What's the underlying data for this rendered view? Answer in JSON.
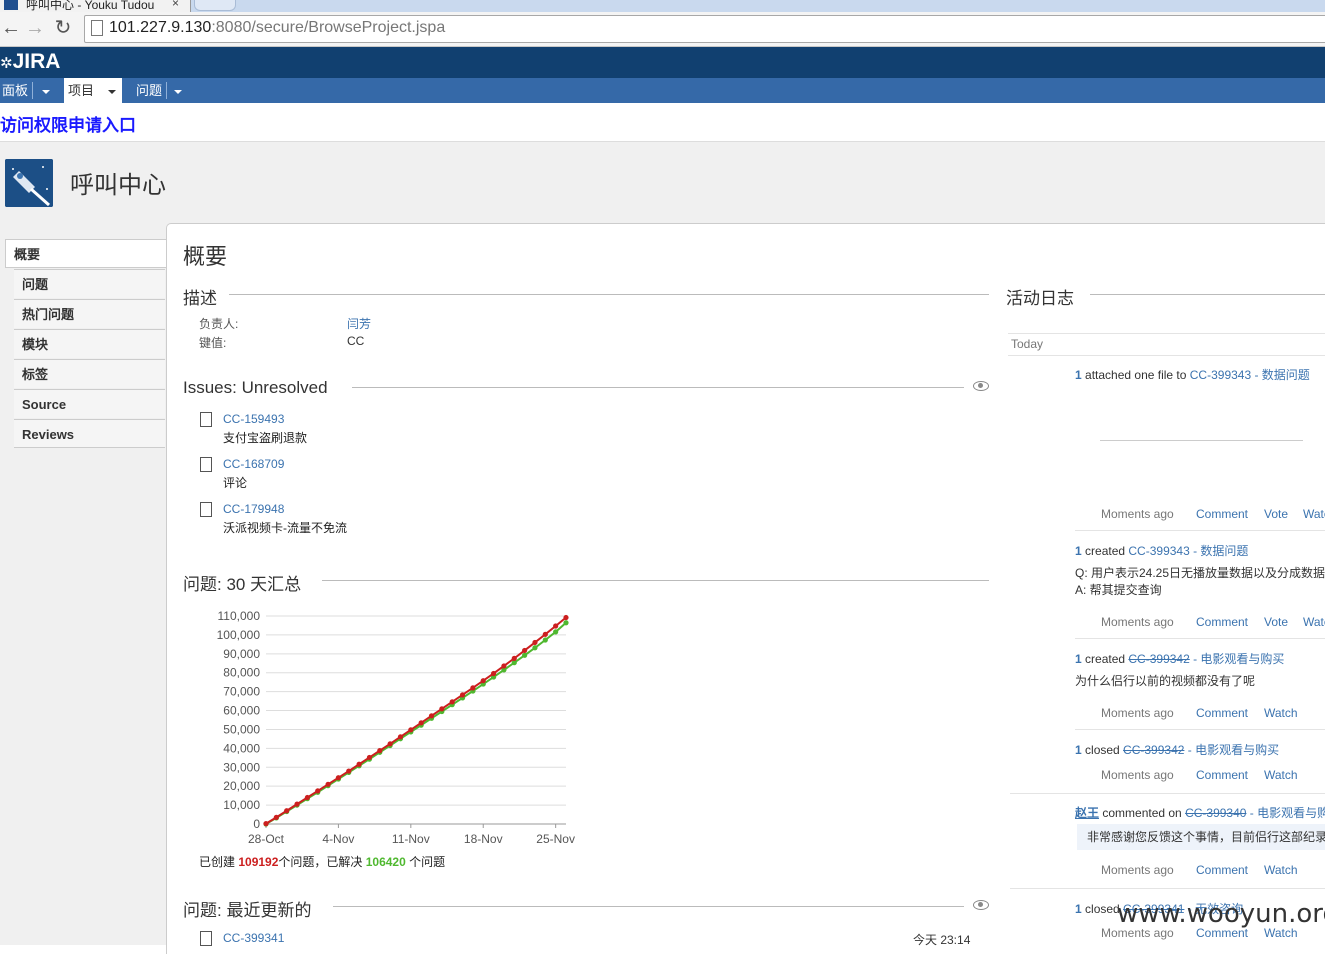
{
  "browser": {
    "tab_title": "呼叫中心 - Youku Tudou",
    "tab_close": "×",
    "url_host": "101.227.9.130",
    "url_rest": ":8080/secure/BrowseProject.jspa"
  },
  "jira": {
    "logo": "JIRA",
    "nav": [
      "面板",
      "项目",
      "问题"
    ],
    "access_link": "访问权限申请入口",
    "project_name": "呼叫中心"
  },
  "menu": [
    "概要",
    "问题",
    "热门问题",
    "模块",
    "标签",
    "Source",
    "Reviews"
  ],
  "summary": {
    "title": "概要",
    "description": {
      "title": "描述",
      "lead_label": "负责人:",
      "lead_value": "闫芳",
      "key_label": "键值:",
      "key_value": "CC"
    },
    "unresolved": {
      "title": "Issues: Unresolved",
      "items": [
        {
          "key": "CC-159493",
          "summary": "支付宝盗刷退款"
        },
        {
          "key": "CC-168709",
          "summary": "评论"
        },
        {
          "key": "CC-179948",
          "summary": "沃派视频卡-流量不免流"
        }
      ]
    },
    "chart_section_title": "问题: 30 天汇总",
    "stats": {
      "prefix": "已创建 ",
      "created": "109192",
      "middle": "个问题，已解决 ",
      "resolved": "106420",
      "suffix": " 个问题"
    },
    "recent": {
      "title": "问题: 最近更新的",
      "first_key": "CC-399341",
      "first_time": "今天 23:14"
    }
  },
  "chart_data": {
    "type": "line",
    "title": "",
    "xlabel": "",
    "ylabel": "",
    "x_tick_labels": [
      "28-Oct",
      "4-Nov",
      "11-Nov",
      "18-Nov",
      "25-Nov"
    ],
    "y_tick_labels": [
      "0",
      "10,000",
      "20,000",
      "30,000",
      "40,000",
      "50,000",
      "60,000",
      "70,000",
      "80,000",
      "90,000",
      "100,000",
      "110,000"
    ],
    "ylim": [
      0,
      110000
    ],
    "x_days": [
      0,
      1,
      2,
      3,
      4,
      5,
      6,
      7,
      8,
      9,
      10,
      11,
      12,
      13,
      14,
      15,
      16,
      17,
      18,
      19,
      20,
      21,
      22,
      23,
      24,
      25,
      26,
      27,
      28,
      29
    ],
    "series": [
      {
        "name": "created",
        "color": "#cc1f1f",
        "values": [
          200,
          3500,
          7000,
          10500,
          14000,
          17500,
          21000,
          24500,
          28000,
          31600,
          35200,
          38800,
          42400,
          46100,
          49800,
          53500,
          57200,
          60900,
          64600,
          68300,
          72000,
          75800,
          79600,
          83600,
          87600,
          91800,
          96000,
          100300,
          104700,
          109192
        ]
      },
      {
        "name": "resolved",
        "color": "#4fb82f",
        "values": [
          0,
          3200,
          6600,
          10000,
          13400,
          16800,
          20300,
          23800,
          27300,
          30800,
          34300,
          37900,
          41500,
          45100,
          48700,
          52300,
          55900,
          59500,
          63100,
          66700,
          70300,
          74000,
          77700,
          81500,
          85300,
          89200,
          93200,
          97300,
          101600,
          106420
        ]
      }
    ],
    "grid": true,
    "legend": "none"
  },
  "activity": {
    "title": "活动日志",
    "today": "Today",
    "entries": [
      {
        "num": "1",
        "text": " attached one file to ",
        "key": "CC-399343",
        "key_strike": false,
        "tail": " - 数据问题",
        "detail1": "",
        "detail2": "",
        "meta": "Moments ago",
        "actions": [
          "Comment",
          "Vote",
          "Watch"
        ]
      },
      {
        "num": "1",
        "text": " created ",
        "key": "CC-399343",
        "key_strike": false,
        "tail": " - 数据问题",
        "detail1": "Q:  用户表示24.25日无播放量数据以及分成数据",
        "detail2": "A:  帮其提交查询",
        "meta": "Moments ago",
        "actions": [
          "Comment",
          "Vote",
          "Watch"
        ]
      },
      {
        "num": "1",
        "text": " created ",
        "key": "CC-399342",
        "key_strike": true,
        "tail": " - 电影观看与购买",
        "detail1": "为什么侣行以前的视频都没有了呢",
        "detail2": "",
        "meta": "Moments ago",
        "actions": [
          "Comment",
          "Watch"
        ]
      },
      {
        "num": "1",
        "text": " closed ",
        "key": "CC-399342",
        "key_strike": true,
        "tail": " - 电影观看与购买",
        "detail1": "",
        "detail2": "",
        "meta": "Moments ago",
        "actions": [
          "Comment",
          "Watch"
        ]
      },
      {
        "num": "赵王",
        "text": " commented on ",
        "key": "CC-399340",
        "key_strike": true,
        "tail": " - 电影观看与购",
        "detail1": "非常感谢您反馈这个事情，目前侣行这部纪录",
        "detail2": "",
        "meta": "Moments ago",
        "actions": [
          "Comment",
          "Watch"
        ]
      },
      {
        "num": "1",
        "text": " closed ",
        "key": "CC-399341",
        "key_strike": true,
        "tail": " - 无效咨询",
        "detail1": "",
        "detail2": "",
        "meta": "Moments ago",
        "actions": [
          "Comment",
          "Watch"
        ]
      }
    ]
  },
  "watermark": "www.wooyun.org"
}
